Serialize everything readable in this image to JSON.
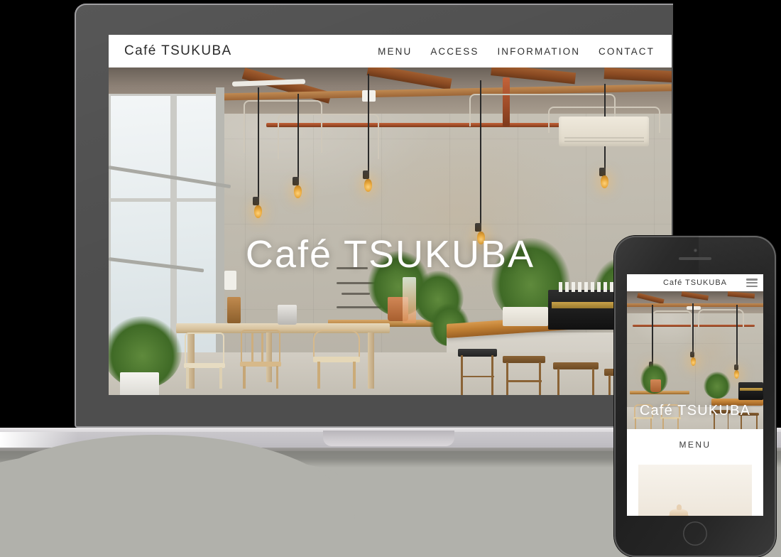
{
  "scene": {
    "title": "Responsive website mockup on laptop and smartphone",
    "background_color": "#000000",
    "ground_color": "#b1b1ab"
  },
  "devices": {
    "laptop": {
      "name": "laptop",
      "bezel_color": "#4e4e4e",
      "base_color": "#c4c2c6"
    },
    "phone": {
      "name": "smartphone",
      "bezel_color": "#242424"
    }
  },
  "desktop_site": {
    "header": {
      "brand": "Café TSUKUBA",
      "nav": [
        {
          "label": "MENU"
        },
        {
          "label": "ACCESS"
        },
        {
          "label": "INFORMATION"
        },
        {
          "label": "CONTACT"
        }
      ]
    },
    "hero": {
      "title": "Café TSUKUBA",
      "image_alt": "Café interior with concrete walls, wooden beams, pendant lights, long wooden table with chairs and a bar counter with stools"
    }
  },
  "mobile_site": {
    "header": {
      "brand": "Café TSUKUBA",
      "menu_icon": "hamburger-icon"
    },
    "hero": {
      "title": "Café TSUKUBA"
    },
    "sections": [
      {
        "title": "MENU"
      }
    ],
    "content": {
      "image_alt": "Ceramic teapot with fresh greens and a red berry"
    }
  }
}
